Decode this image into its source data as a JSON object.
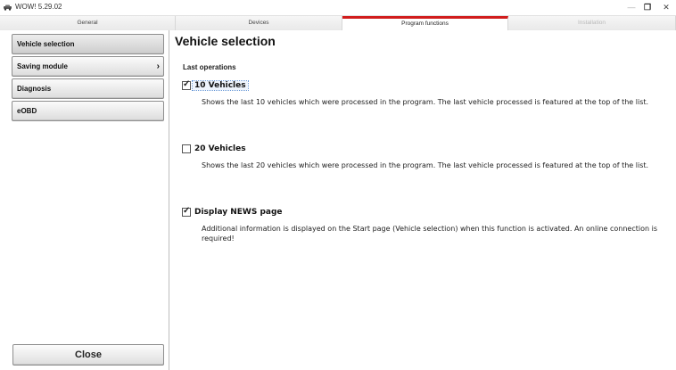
{
  "window": {
    "title": "WOW! 5.29.02",
    "icon": "car-icon",
    "controls": {
      "minimize": "—",
      "maximize": "❐",
      "close": "✕"
    }
  },
  "tabs": [
    {
      "label": "General",
      "state": "normal"
    },
    {
      "label": "Devices",
      "state": "normal"
    },
    {
      "label": "Program functions",
      "state": "active"
    },
    {
      "label": "Installation",
      "state": "disabled"
    }
  ],
  "sidebar": {
    "items": [
      {
        "label": "Vehicle selection",
        "selected": true,
        "has_submenu": false
      },
      {
        "label": "Saving module",
        "selected": false,
        "has_submenu": true
      },
      {
        "label": "Diagnosis",
        "selected": false,
        "has_submenu": false
      },
      {
        "label": "eOBD",
        "selected": false,
        "has_submenu": false
      }
    ],
    "submenu_chevron": "›",
    "close_label": "Close"
  },
  "main": {
    "title": "Vehicle selection",
    "section_label": "Last operations",
    "options": [
      {
        "label": "10 Vehicles",
        "checked": true,
        "description": "Shows the last 10 vehicles which were processed in the program. The last vehicle processed is featured at the top of the list."
      },
      {
        "label": "20 Vehicles",
        "checked": false,
        "description": "Shows the last 20 vehicles which were processed in the program. The last vehicle processed is featured at the top of the list."
      },
      {
        "label": "Display NEWS page",
        "checked": true,
        "description": "Additional information is displayed on the Start page (Vehicle selection) when this function is activated. An online connection is required!"
      }
    ]
  },
  "colors": {
    "active_tab_accent": "#d11d1d",
    "focus_outline": "#6b9ad8"
  }
}
